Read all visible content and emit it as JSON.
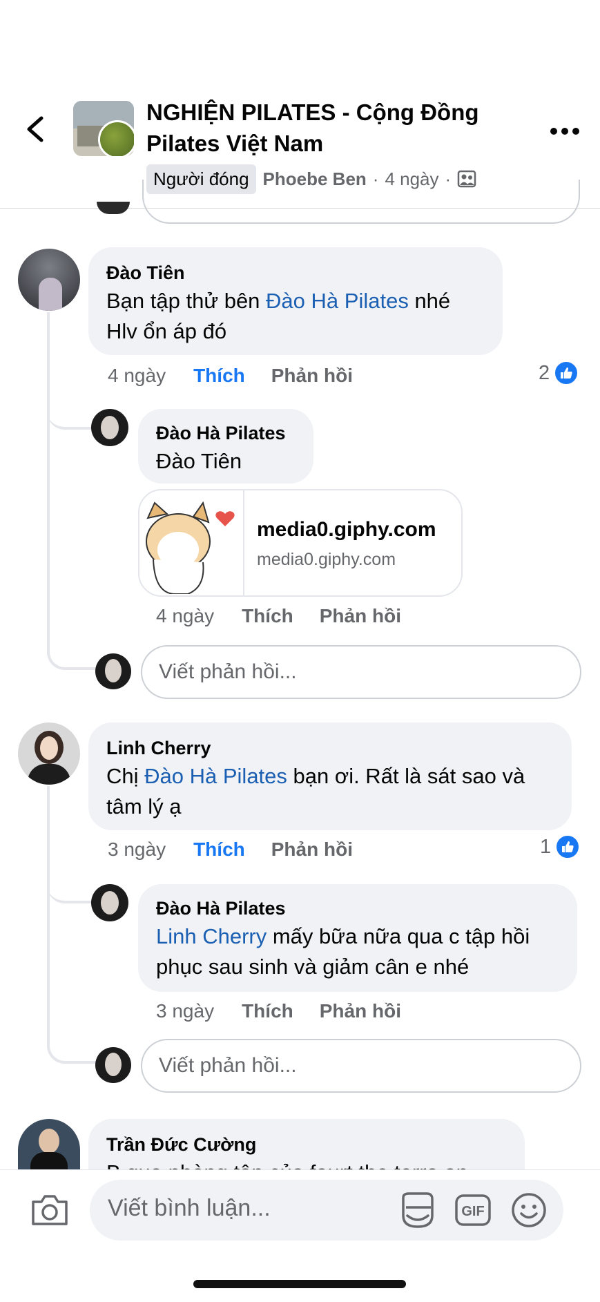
{
  "header": {
    "group_title": "NGHIỆN PILATES - Cộng Đồng Pilates Việt Nam",
    "badge": "Người đóng",
    "author": "Phoebe Ben",
    "separator": "·",
    "time": "4 ngày",
    "separator2": "·"
  },
  "comments": [
    {
      "name": "Đào Tiên",
      "text_before": "Bạn tập thử bên ",
      "mention": "Đào Hà Pilates",
      "text_after": " nhé Hlv ổn áp đó",
      "time": "4 ngày",
      "like": "Thích",
      "reply": "Phản hồi",
      "reaction_count": "2",
      "replies": [
        {
          "name": "Đào Hà Pilates",
          "mention": "Đào Tiên",
          "link_title": "media0.giphy.com",
          "link_domain": "media0.giphy.com",
          "time": "4 ngày",
          "like": "Thích",
          "reply": "Phản hồi"
        }
      ],
      "reply_placeholder": "Viết phản hồi..."
    },
    {
      "name": "Linh Cherry",
      "text_before": "Chị ",
      "mention": "Đào Hà Pilates",
      "text_after": " bạn ơi. Rất là sát sao và tâm lý ạ",
      "time": "3 ngày",
      "like": "Thích",
      "reply": "Phản hồi",
      "reaction_count": "1",
      "replies": [
        {
          "name": "Đào Hà Pilates",
          "mention": "Linh Cherry",
          "text_after": " mấy bữa nữa qua c tập hồi phục sau sinh và giảm cân e nhé",
          "time": "3 ngày",
          "like": "Thích",
          "reply": "Phản hồi"
        }
      ],
      "reply_placeholder": "Viết phản hồi..."
    },
    {
      "name": "Trần Đức Cường",
      "text": "B qua phòng tập của fourt the terra an"
    }
  ],
  "composer": {
    "placeholder": "Viết bình luận..."
  },
  "colors": {
    "link": "#1b5fb3",
    "like_active": "#1877f2",
    "bubble": "#f0f2f5",
    "muted": "#65676b"
  }
}
